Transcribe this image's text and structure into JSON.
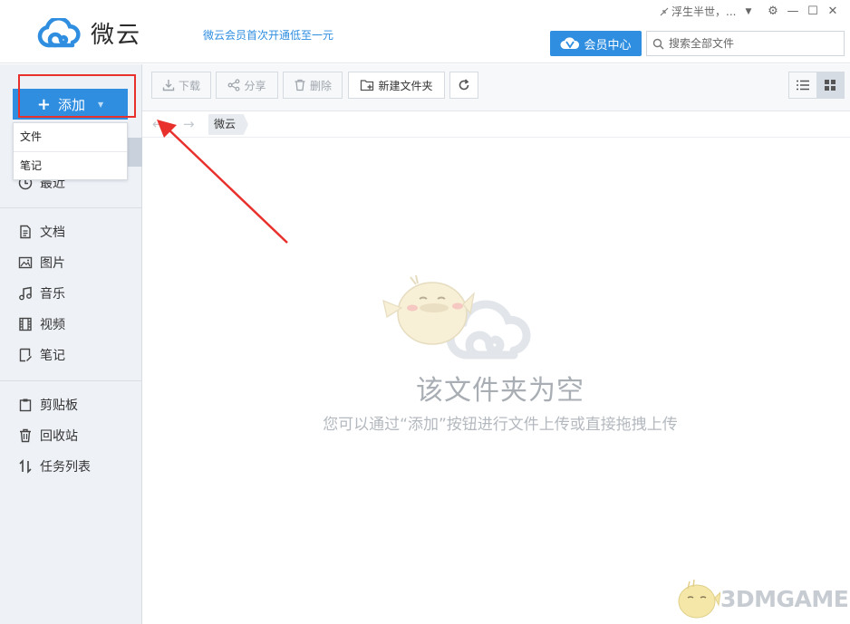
{
  "header": {
    "app_name": "微云",
    "promo": "微云会员首次开通低至一元",
    "user_name": "浮生半世，...",
    "vip_button": "会员中心",
    "search_placeholder": "搜索全部文件"
  },
  "sidebar": {
    "add_button": "添加",
    "add_menu": [
      "文件",
      "笔记"
    ],
    "recent": "最近",
    "categories": [
      "文档",
      "图片",
      "音乐",
      "视频",
      "笔记"
    ],
    "tools": [
      "剪贴板",
      "回收站",
      "任务列表"
    ]
  },
  "toolbar": {
    "download": "下载",
    "share": "分享",
    "delete": "删除",
    "new_folder": "新建文件夹"
  },
  "breadcrumb": {
    "current": "微云"
  },
  "empty_state": {
    "title": "该文件夹为空",
    "hint": "您可以通过“添加”按钮进行文件上传或直接拖拽上传"
  },
  "watermark": {
    "text": "3DMGAME"
  },
  "colors": {
    "accent": "#2f8ee0",
    "annotation_red": "#e8312c",
    "sidebar_bg": "#eef2f7"
  }
}
